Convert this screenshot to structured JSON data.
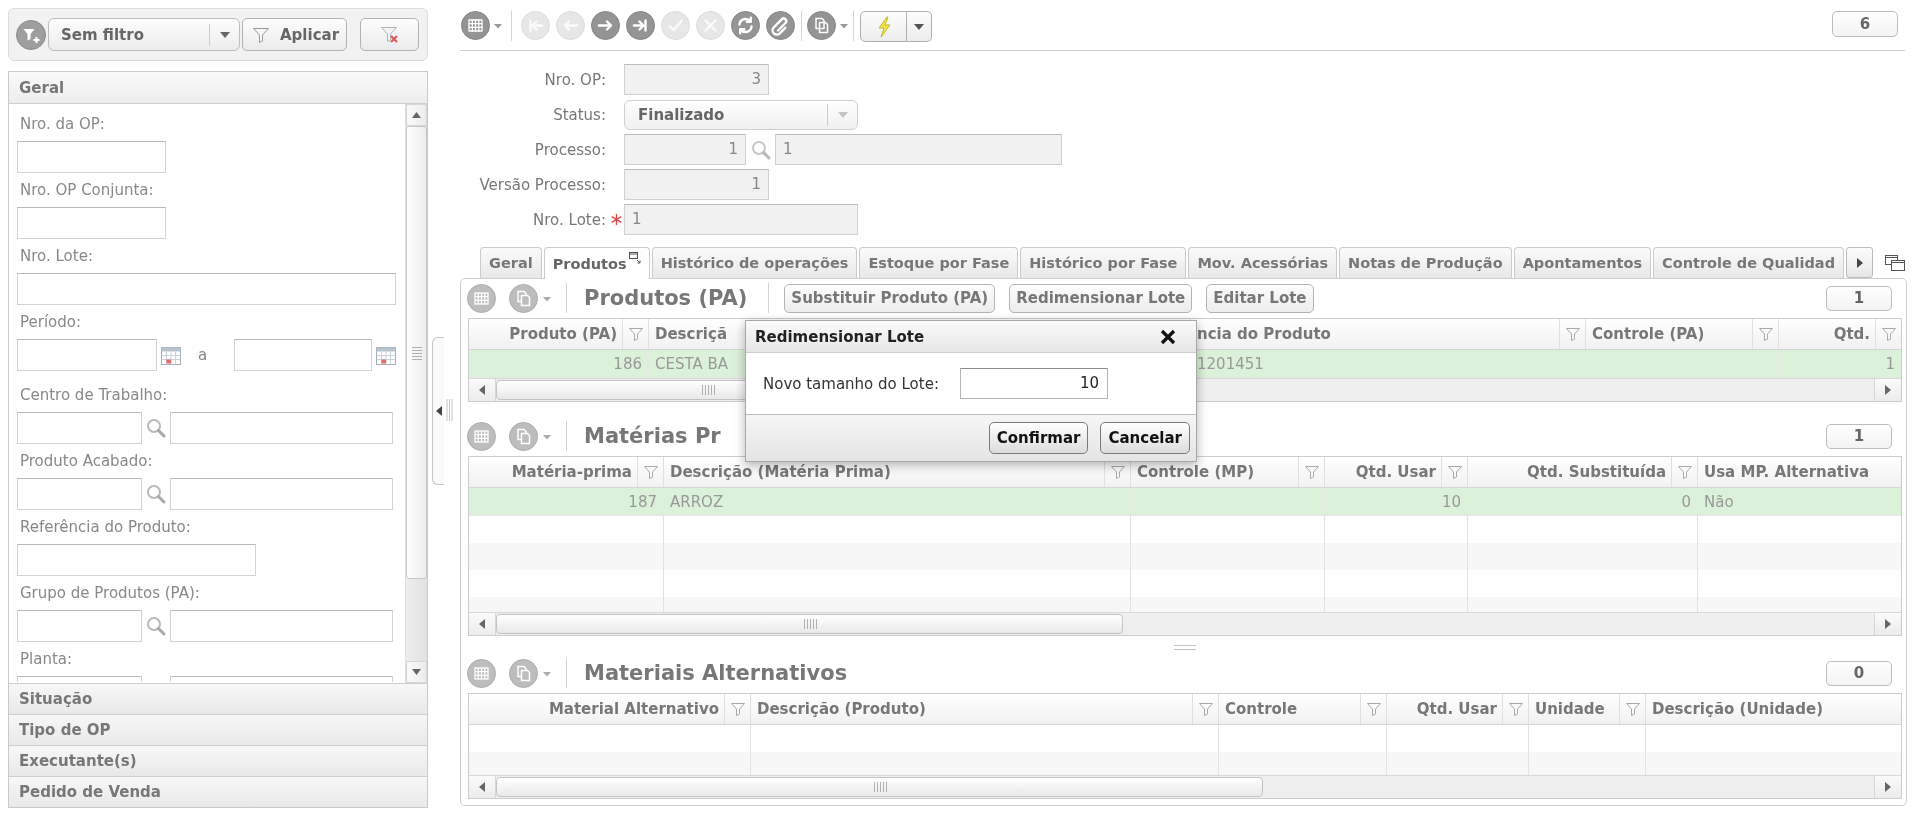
{
  "filter_bar": {
    "preset": "Sem filtro",
    "apply_label": "Aplicar"
  },
  "sidebar": {
    "sections": [
      {
        "title": "Geral",
        "expanded": true,
        "fields": [
          {
            "label": "Nro. da OP:",
            "kind": "short"
          },
          {
            "label": "Nro. OP Conjunta:",
            "kind": "short"
          },
          {
            "label": "Nro. Lote:",
            "kind": "long"
          },
          {
            "label": "Período:",
            "kind": "range",
            "separator": "a"
          },
          {
            "label": "Centro de Trabalho:",
            "kind": "lookup"
          },
          {
            "label": "Produto Acabado:",
            "kind": "lookup"
          },
          {
            "label": "Referência do Produto:",
            "kind": "medium"
          },
          {
            "label": "Grupo de Produtos (PA):",
            "kind": "lookup"
          },
          {
            "label": "Planta:",
            "kind": "lookup"
          }
        ]
      },
      {
        "title": "Situação",
        "expanded": false
      },
      {
        "title": "Tipo de OP",
        "expanded": false
      },
      {
        "title": "Executante(s)",
        "expanded": false
      },
      {
        "title": "Pedido de Venda",
        "expanded": false
      }
    ]
  },
  "toolbar": {
    "buttons": [
      {
        "kind": "table",
        "disabled": false
      },
      {
        "kind": "first",
        "disabled": true
      },
      {
        "kind": "previous",
        "disabled": true
      },
      {
        "kind": "next",
        "disabled": false
      },
      {
        "kind": "last",
        "disabled": false
      },
      {
        "kind": "confirm",
        "disabled": true
      },
      {
        "kind": "cancel",
        "disabled": true
      },
      {
        "kind": "refresh",
        "disabled": false
      },
      {
        "kind": "attach",
        "disabled": false
      },
      {
        "kind": "documents",
        "disabled": false
      },
      {
        "kind": "actions",
        "disabled": false
      }
    ],
    "record_count": "6"
  },
  "form": {
    "fields": [
      {
        "label": "Nro. OP:",
        "kind": "number",
        "value": "3",
        "disabled": true,
        "required": false
      },
      {
        "label": "Status:",
        "kind": "select",
        "value": "Finalizado",
        "disabled": true,
        "required": false
      },
      {
        "label": "Processo:",
        "kind": "lookup",
        "value": "1",
        "description": "1",
        "disabled": true,
        "required": false
      },
      {
        "label": "Versão Processo:",
        "kind": "number",
        "value": "1",
        "disabled": true,
        "required": false
      },
      {
        "label": "Nro. Lote:",
        "kind": "text",
        "value": "1",
        "disabled": true,
        "required": true
      }
    ]
  },
  "tabs": [
    {
      "label": "Geral",
      "selected": false
    },
    {
      "label": "Produtos",
      "selected": true
    },
    {
      "label": "Histórico de operações",
      "selected": false
    },
    {
      "label": "Estoque por Fase",
      "selected": false
    },
    {
      "label": "Histórico por Fase",
      "selected": false
    },
    {
      "label": "Mov. Acessórias",
      "selected": false
    },
    {
      "label": "Notas de Produção",
      "selected": false
    },
    {
      "label": "Apontamentos",
      "selected": false
    },
    {
      "label": "Controle de Qualidad",
      "selected": false
    }
  ],
  "sections": [
    {
      "title": "Produtos (PA)",
      "buttons": [
        "Substituir Produto (PA)",
        "Redimensionar Lote",
        "Editar Lote"
      ],
      "count": "1",
      "grid": {
        "columns": [
          {
            "label": "Produto (PA)",
            "kind": "number",
            "filter": true
          },
          {
            "label": "Descriçã",
            "kind": "text",
            "filter": false
          },
          {
            "label": "ncia do Produto",
            "kind": "text",
            "filter": true
          },
          {
            "label": "Controle (PA)",
            "kind": "text",
            "filter": true
          },
          {
            "label": "Qtd.",
            "kind": "number",
            "filter": true
          }
        ],
        "rows": [
          {
            "cells": [
              "186",
              "CESTA BA",
              "1201451",
              null,
              "1"
            ],
            "selected": true
          }
        ]
      }
    },
    {
      "title": "Matérias Pr",
      "count": "1",
      "grid": {
        "columns": [
          {
            "label": "Matéria-prima",
            "kind": "number",
            "filter": true
          },
          {
            "label": "Descrição (Matéria Prima)",
            "kind": "text",
            "filter": true
          },
          {
            "label": "Controle (MP)",
            "kind": "text",
            "filter": true
          },
          {
            "label": "Qtd. Usar",
            "kind": "number",
            "filter": true
          },
          {
            "label": "Qtd. Substituída",
            "kind": "number",
            "filter": true
          },
          {
            "label": "Usa MP. Alternativa",
            "kind": "text",
            "filter": false
          }
        ],
        "rows": [
          {
            "cells": [
              "187",
              "ARROZ",
              null,
              "10",
              "0",
              "Não"
            ],
            "selected": true
          }
        ]
      }
    },
    {
      "title": "Materiais Alternativos",
      "count": "0",
      "grid": {
        "columns": [
          {
            "label": "Material Alternativo",
            "kind": "number",
            "filter": true
          },
          {
            "label": "Descrição (Produto)",
            "kind": "text",
            "filter": true
          },
          {
            "label": "Controle",
            "kind": "text",
            "filter": true
          },
          {
            "label": "Qtd. Usar",
            "kind": "number",
            "filter": true
          },
          {
            "label": "Unidade",
            "kind": "text",
            "filter": true
          },
          {
            "label": "Descrição (Unidade)",
            "kind": "text",
            "filter": false
          }
        ]
      }
    }
  ],
  "dialog": {
    "title": "Redimensionar Lote",
    "label": "Novo tamanho do Lote:",
    "value": "10",
    "buttons": [
      "Confirmar",
      "Cancelar"
    ]
  }
}
